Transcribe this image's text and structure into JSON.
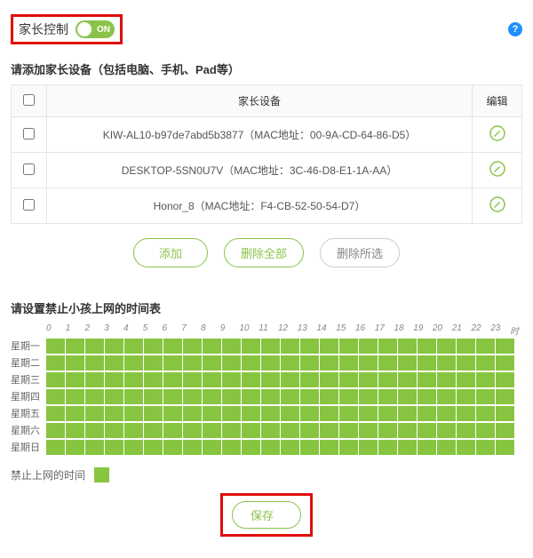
{
  "header": {
    "title": "家长控制",
    "switch_text": "ON",
    "help_glyph": "?"
  },
  "devices_section": {
    "title": "请添加家长设备（包括电脑、手机、Pad等）",
    "columns": {
      "check": "",
      "device": "家长设备",
      "edit": "编辑"
    },
    "rows": [
      {
        "label": "KIW-AL10-b97de7abd5b3877（MAC地址：00-9A-CD-64-86-D5）"
      },
      {
        "label": "DESKTOP-5SN0U7V（MAC地址：3C-46-D8-E1-1A-AA）"
      },
      {
        "label": "Honor_8（MAC地址：F4-CB-52-50-54-D7）"
      }
    ],
    "buttons": {
      "add": "添加",
      "delete_all": "删除全部",
      "delete_selected": "删除所选"
    }
  },
  "schedule_section": {
    "title": "请设置禁止小孩上网的时间表",
    "hours": [
      "0",
      "1",
      "2",
      "3",
      "4",
      "5",
      "6",
      "7",
      "8",
      "9",
      "10",
      "11",
      "12",
      "13",
      "14",
      "15",
      "16",
      "17",
      "18",
      "19",
      "20",
      "21",
      "22",
      "23"
    ],
    "hours_suffix": "时",
    "days": [
      "星期一",
      "星期二",
      "星期三",
      "星期四",
      "星期五",
      "星期六",
      "星期日"
    ],
    "legend": "禁止上网的时间"
  },
  "save_label": "保存"
}
